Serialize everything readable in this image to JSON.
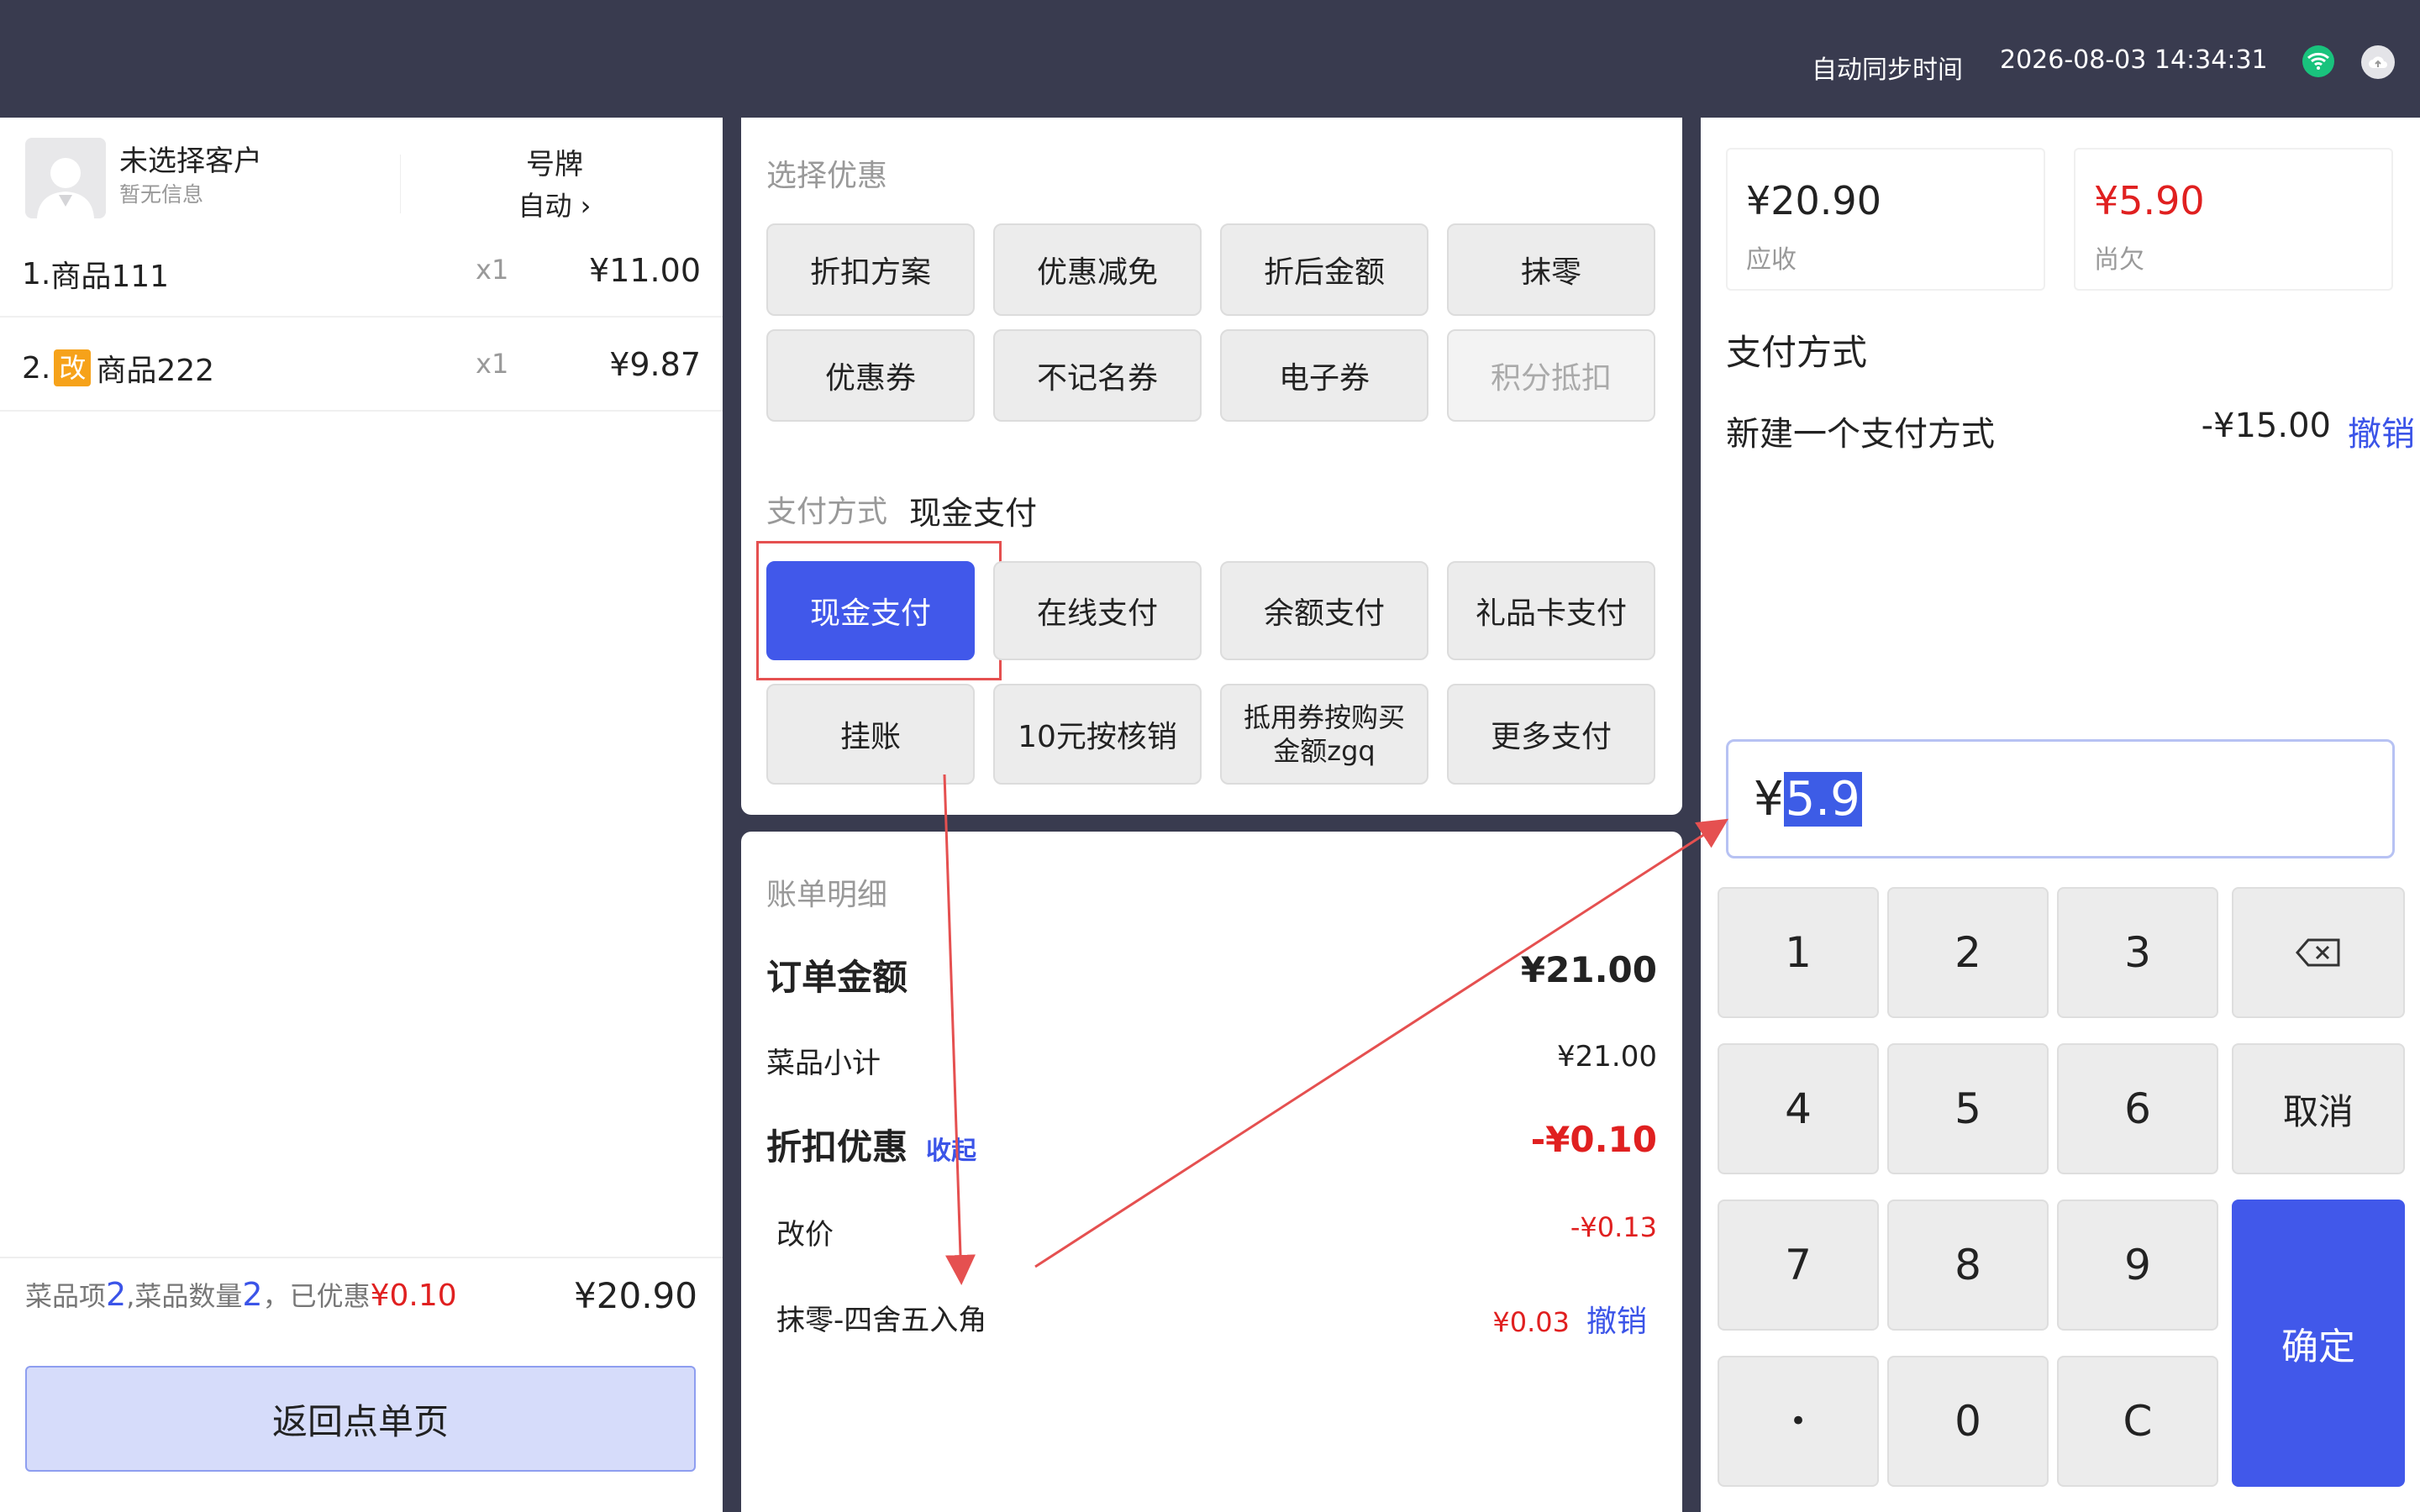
{
  "topbar": {
    "sync_label": "自动同步时间",
    "datetime": "2026-08-03 14:34:31",
    "wifi_icon": "wifi-icon",
    "cloud_icon": "cloud-icon"
  },
  "customer": {
    "name": "未选择客户",
    "sub": "暂无信息",
    "plate_label": "号牌",
    "plate_value": "自动 ›"
  },
  "items": [
    {
      "index": "1.",
      "badge": "",
      "name": "商品111",
      "qty": "x1",
      "price": "¥11.00"
    },
    {
      "index": "2.",
      "badge": "改",
      "name": "商品222",
      "qty": "x1",
      "price": "¥9.87"
    }
  ],
  "left_footer": {
    "s1": "菜品项",
    "n1": "2",
    "s2": ",菜品数量",
    "n2": "2",
    "s3": "，已优惠",
    "discount": "¥0.10",
    "total": "¥20.90",
    "back_button": "返回点单页"
  },
  "discounts": {
    "title": "选择优惠",
    "buttons": [
      "折扣方案",
      "优惠减免",
      "折后金额",
      "抹零",
      "优惠券",
      "不记名券",
      "电子券",
      "积分抵扣"
    ]
  },
  "payment": {
    "label": "支付方式",
    "current": "现金支付",
    "buttons": [
      "现金支付",
      "在线支付",
      "余额支付",
      "礼品卡支付",
      "挂账",
      "10元按核销",
      "抵用券按购买金额zgq",
      "更多支付"
    ]
  },
  "bill": {
    "title": "账单明细",
    "order_label": "订单金额",
    "order_value": "¥21.00",
    "subtotal_label": "菜品小计",
    "subtotal_value": "¥21.00",
    "discount_label": "折扣优惠",
    "collapse": "收起",
    "discount_value": "-¥0.10",
    "mod_label": "改价",
    "mod_value": "-¥0.13",
    "round_label": "抹零-四舍五入角",
    "round_value": "¥0.03",
    "round_undo": "撤销"
  },
  "right": {
    "receivable": "¥20.90",
    "receivable_label": "应收",
    "owed": "¥5.90",
    "owed_label": "尚欠",
    "pm_title": "支付方式",
    "pm_name": "新建一个支付方式",
    "pm_amount": "-¥15.00",
    "pm_undo": "撤销",
    "input_prefix": "¥",
    "input_value": "5.9"
  },
  "keypad": {
    "k1": "1",
    "k2": "2",
    "k3": "3",
    "k4": "4",
    "k5": "5",
    "k6": "6",
    "cancel": "取消",
    "k7": "7",
    "k8": "8",
    "k9": "9",
    "dot": "•",
    "k0": "0",
    "clear": "C",
    "confirm": "确定"
  },
  "colors": {
    "primary": "#4158ea",
    "danger": "#e02020",
    "link": "#3b54e8",
    "topbar": "#393b4f",
    "annotation": "#e55050"
  }
}
